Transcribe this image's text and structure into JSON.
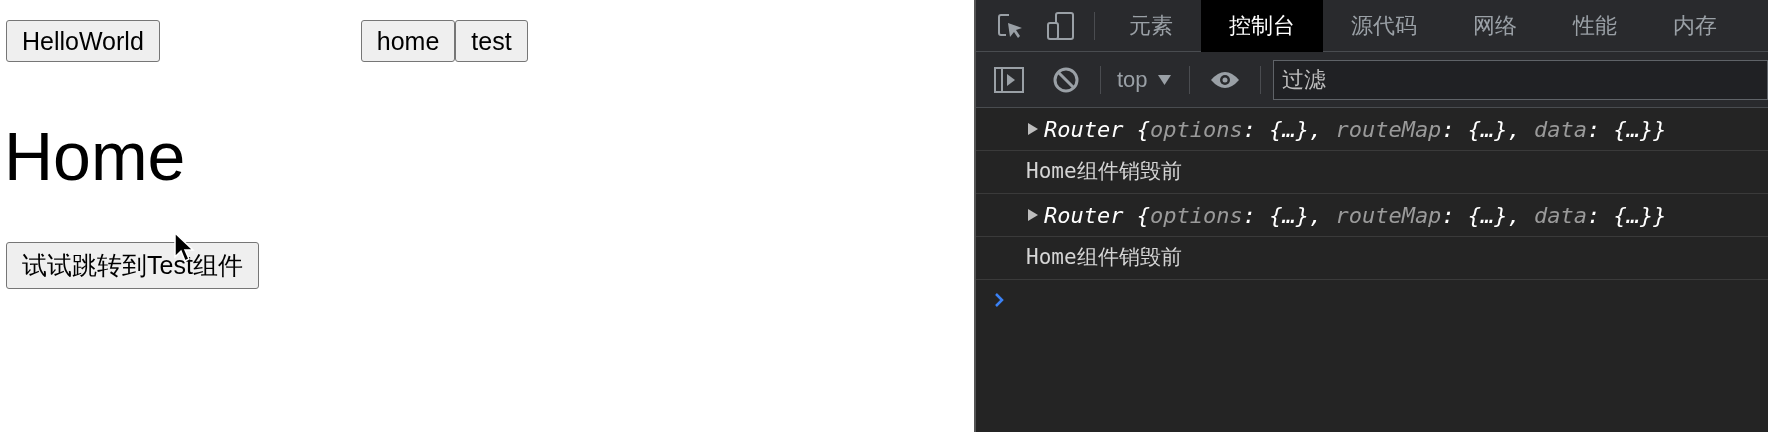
{
  "page": {
    "nav_left": [
      "HelloWorld"
    ],
    "nav_right": [
      "home",
      "test"
    ],
    "heading": "Home",
    "action_button": "试试跳转到Test组件"
  },
  "devtools": {
    "tabs": [
      {
        "label": "元素",
        "selected": false
      },
      {
        "label": "控制台",
        "selected": true
      },
      {
        "label": "源代码",
        "selected": false
      },
      {
        "label": "网络",
        "selected": false
      },
      {
        "label": "性能",
        "selected": false
      },
      {
        "label": "内存",
        "selected": false
      }
    ],
    "context": "top",
    "filter": {
      "placeholder": "过滤"
    },
    "console": [
      {
        "kind": "object",
        "segments": [
          {
            "kind": "punct",
            "text": "Router {"
          },
          {
            "kind": "key",
            "text": "options"
          },
          {
            "kind": "punct",
            "text": ": {…}, "
          },
          {
            "kind": "key",
            "text": "routeMap"
          },
          {
            "kind": "punct",
            "text": ": {…}, "
          },
          {
            "kind": "key",
            "text": "data"
          },
          {
            "kind": "punct",
            "text": ": {…}}"
          }
        ]
      },
      {
        "kind": "text",
        "text": "Home组件销毁前"
      },
      {
        "kind": "object",
        "segments": [
          {
            "kind": "punct",
            "text": "Router {"
          },
          {
            "kind": "key",
            "text": "options"
          },
          {
            "kind": "punct",
            "text": ": {…}, "
          },
          {
            "kind": "key",
            "text": "routeMap"
          },
          {
            "kind": "punct",
            "text": ": {…}, "
          },
          {
            "kind": "key",
            "text": "data"
          },
          {
            "kind": "punct",
            "text": ": {…}}"
          }
        ]
      },
      {
        "kind": "text",
        "text": "Home组件销毁前"
      }
    ]
  }
}
